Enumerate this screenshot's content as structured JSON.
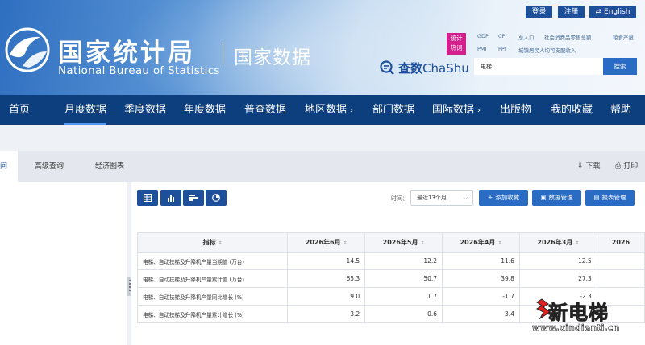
{
  "header": {
    "org_cn": "国家统计局",
    "org_en": "National Bureau of Statistics",
    "site_title": "国家数据",
    "login": "登录",
    "register": "注册",
    "english": "English",
    "hot_label": "统计\n热词",
    "hot_tags": [
      "GDP",
      "CPI",
      "总人口",
      "社会消费品零售总额",
      "粮食产量",
      "PMI",
      "PPI",
      "城镇居民人均可支配收入"
    ],
    "chashu_cn": "查数",
    "chashu_en": "ChaShu",
    "search_value": "电梯",
    "search_button": "搜索"
  },
  "nav": {
    "items": [
      {
        "label": "首页"
      },
      {
        "label": "月度数据"
      },
      {
        "label": "季度数据"
      },
      {
        "label": "年度数据"
      },
      {
        "label": "普查数据"
      },
      {
        "label": "地区数据",
        "arrow": "›"
      },
      {
        "label": "部门数据"
      },
      {
        "label": "国际数据",
        "arrow": "›"
      },
      {
        "label": "出版物"
      },
      {
        "label": "我的收藏"
      },
      {
        "label": "帮助"
      }
    ]
  },
  "tabs": {
    "items": [
      "间",
      "高级查询",
      "经济图表"
    ],
    "download": "下载",
    "print": "打印"
  },
  "toolbar": {
    "time_label": "时间：",
    "time_value": "最近13个月",
    "add_favorite": "添加收藏",
    "data_manage": "数据管理",
    "report_manage": "报表管理",
    "view_modes": [
      "table-view-icon",
      "bar-chart-icon",
      "bar-horizontal-icon",
      "pie-chart-icon"
    ]
  },
  "table": {
    "headers": [
      "指标",
      "2026年6月",
      "2026年5月",
      "2026年4月",
      "2026年3月",
      "2026"
    ],
    "rows": [
      {
        "name": "电梯、自动扶梯及升降机产量当期值 (万台)",
        "values": [
          "14.5",
          "12.2",
          "11.6",
          "12.5",
          ""
        ]
      },
      {
        "name": "电梯、自动扶梯及升降机产量累计值 (万台)",
        "values": [
          "65.3",
          "50.7",
          "39.8",
          "27.3",
          ""
        ]
      },
      {
        "name": "电梯、自动扶梯及升降机产量同比增长 (%)",
        "values": [
          "9.0",
          "1.7",
          "-1.7",
          "-2.3",
          ""
        ]
      },
      {
        "name": "电梯、自动扶梯及升降机产量累计增长 (%)",
        "values": [
          "3.2",
          "0.6",
          "3.4",
          "",
          ""
        ]
      }
    ]
  },
  "watermark": {
    "title": "新电梯",
    "url": "www.xindianti.cn"
  },
  "colors": {
    "nav_bg": "#0d3f7e",
    "button_blue": "#2a6cc4",
    "dark_blue": "#1d4f9a",
    "hot_badge": "#d41e8c"
  }
}
